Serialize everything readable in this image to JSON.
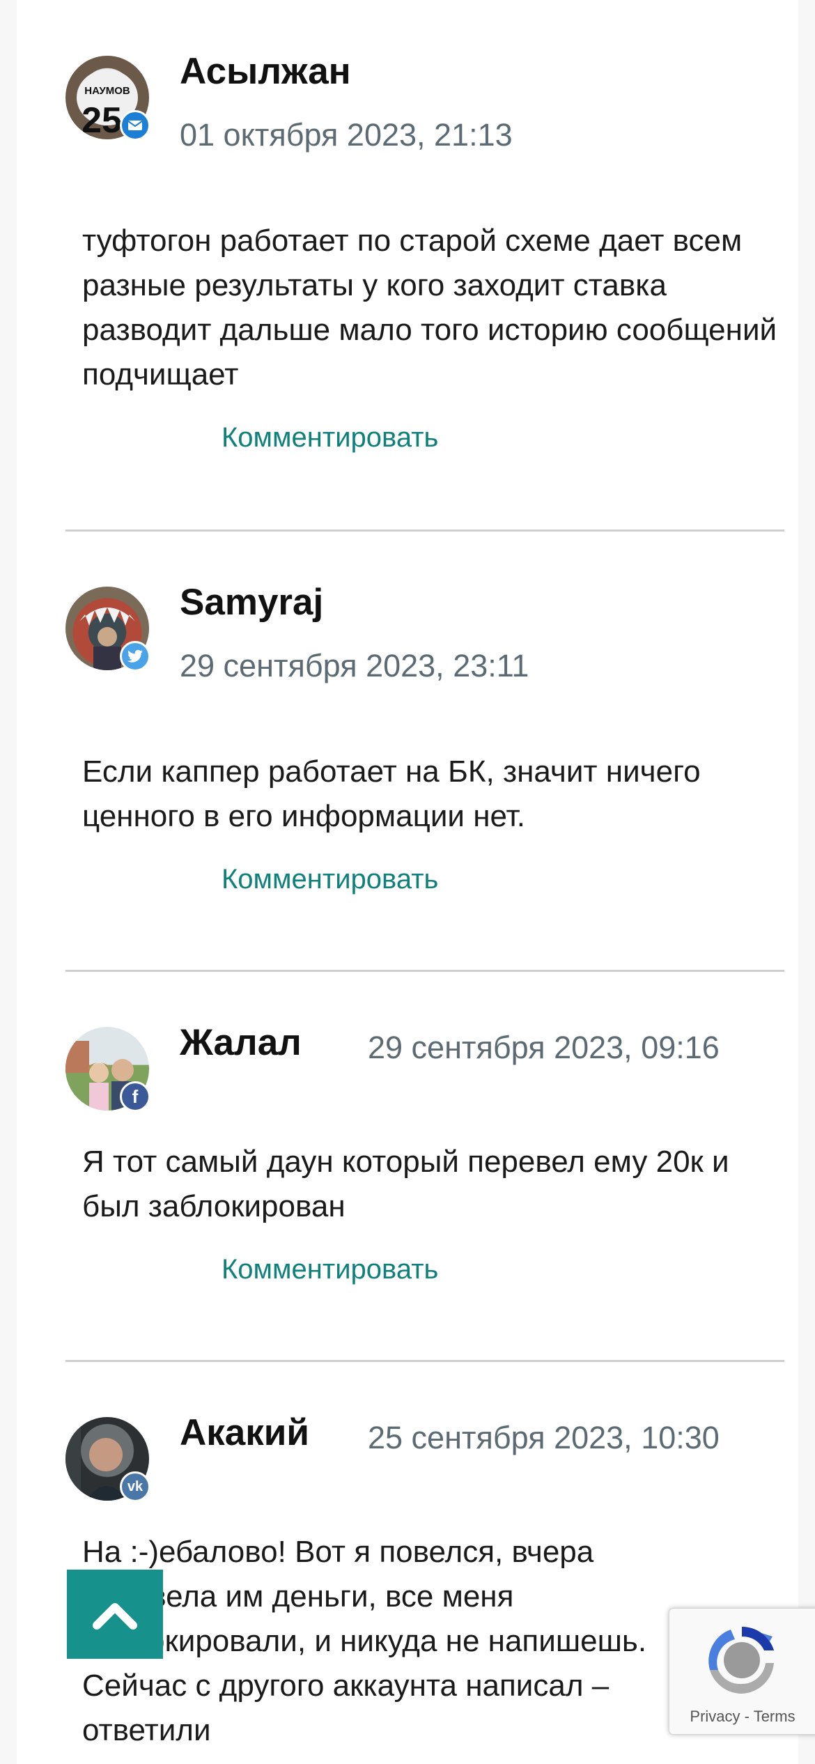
{
  "comments": [
    {
      "author": "Асылжан",
      "date": "01 октября 2023, 21:13",
      "text": "туфтогон работает по старой схеме дает всем разные результаты у кого заходит ставка разводит дальше мало того историю сообщений подчищает",
      "reply_label": "Комментировать",
      "badge_icon": "mail-icon",
      "badge_color": "#1b7fd6"
    },
    {
      "author": "Samyraj",
      "date": "29 сентября 2023, 23:11",
      "text": "Если каппер работает на БК, значит ничего ценного в его информации нет.",
      "reply_label": "Комментировать",
      "badge_icon": "twitter-icon",
      "badge_color": "#4aa3e8"
    },
    {
      "author": "Жалал",
      "date": "29 сентября 2023, 09:16",
      "text": "Я тот самый даун который перевел ему 20к и был заблокирован",
      "reply_label": "Комментировать",
      "badge_icon": "facebook-icon",
      "badge_color": "#3b5998"
    },
    {
      "author": "Акакий",
      "date": "25 сентября 2023, 10:30",
      "text": "На :-)ебалово! Вот я повелся, вчера перевела им деньги, все меня заблокировали, и никуда не напишешь. Сейчас с другого аккаунта написал – ответили",
      "reply_label": "",
      "badge_icon": "vk-icon",
      "badge_color": "#4a76a8"
    }
  ],
  "avatar1_jersey": "НАУМОВ 25",
  "scroll_top_icon": "chevron-up-icon",
  "recaptcha": {
    "privacy": "Privacy",
    "separator": " - ",
    "terms": "Terms",
    "icon": "recaptcha-icon"
  },
  "colors": {
    "accent": "#16918b",
    "link": "#10807a",
    "date": "#5c6b73"
  }
}
